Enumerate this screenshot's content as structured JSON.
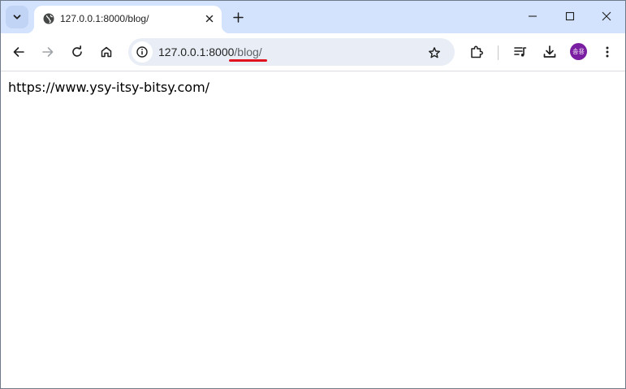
{
  "tab": {
    "title": "127.0.0.1:8000/blog/",
    "favicon": "globe-icon"
  },
  "address_bar": {
    "host": "127.0.0.1:8000",
    "path": "/blog/"
  },
  "profile": {
    "initials": "송용",
    "color": "#7b1fa2"
  },
  "page": {
    "text": "https://www.ysy-itsy-bitsy.com/"
  },
  "colors": {
    "tabstrip_bg": "#d3e3fd",
    "omnibox_bg": "#e9eef6",
    "annotation_underline": "#e0121f"
  }
}
